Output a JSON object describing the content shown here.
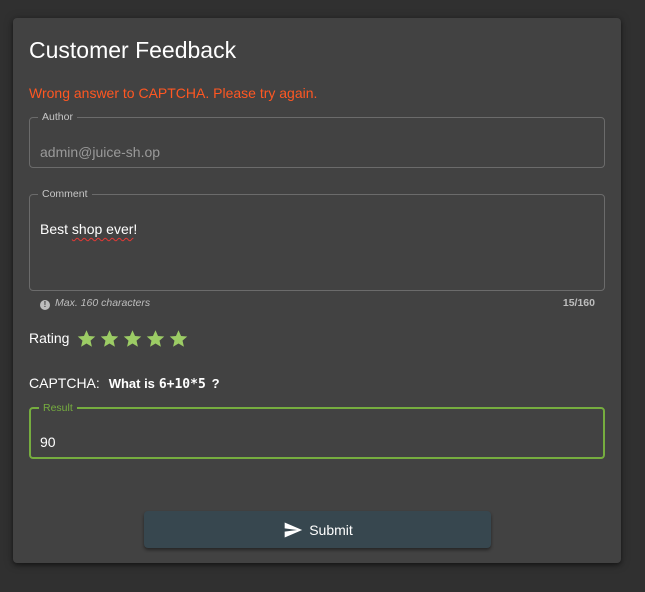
{
  "page": {
    "title": "Customer Feedback",
    "error_message": "Wrong answer to CAPTCHA. Please try again."
  },
  "author": {
    "label": "Author",
    "value": "admin@juice-sh.op"
  },
  "comment": {
    "label": "Comment",
    "value_plain_1": "Best ",
    "value_misspelled": "shop ever",
    "value_plain_2": "!",
    "hint": "Max. 160 characters",
    "counter": "15/160"
  },
  "rating": {
    "label": "Rating",
    "stars_total": 5,
    "stars_selected": 5,
    "star_color": "#9ccc65"
  },
  "captcha": {
    "label": "CAPTCHA:",
    "question_prefix": "What is",
    "expression": "6+10*5",
    "question_suffix": "?"
  },
  "result": {
    "label": "Result",
    "value": "90"
  },
  "submit": {
    "label": "Submit",
    "icon": "send-icon"
  },
  "colors": {
    "background": "#303030",
    "card": "#424242",
    "error": "#ff5722",
    "accent_green": "#76ad3f",
    "button": "#37474f"
  }
}
